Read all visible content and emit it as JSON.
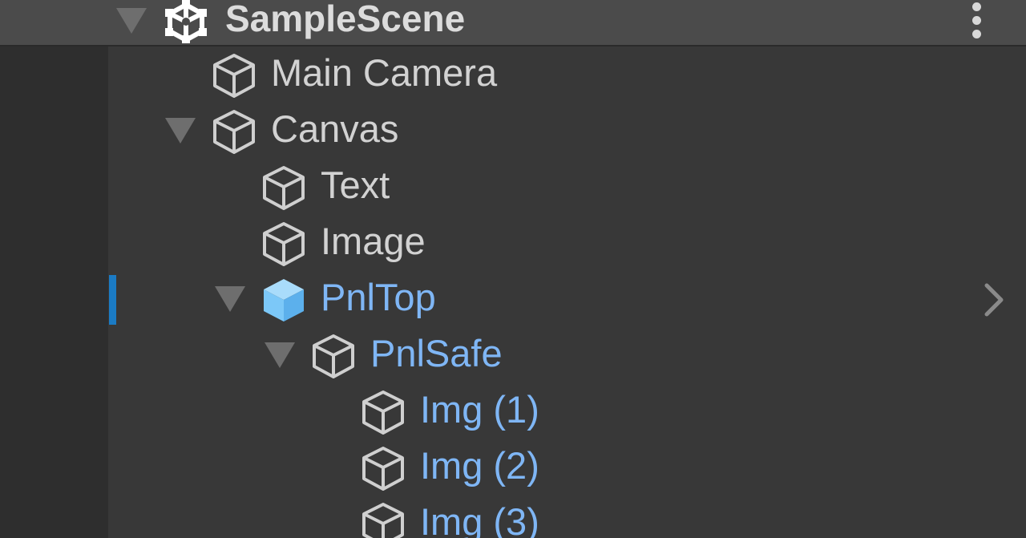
{
  "scene": {
    "name": "SampleScene"
  },
  "hierarchy": [
    {
      "name": "Main Camera",
      "depth": 1,
      "expanded": null,
      "selected": false,
      "highlighted": false
    },
    {
      "name": "Canvas",
      "depth": 1,
      "expanded": true,
      "selected": false,
      "highlighted": false
    },
    {
      "name": "Text",
      "depth": 2,
      "expanded": null,
      "selected": false,
      "highlighted": false
    },
    {
      "name": "Image",
      "depth": 2,
      "expanded": null,
      "selected": false,
      "highlighted": false
    },
    {
      "name": "PnlTop",
      "depth": 2,
      "expanded": true,
      "selected": true,
      "highlighted": true
    },
    {
      "name": "PnlSafe",
      "depth": 3,
      "expanded": true,
      "selected": false,
      "highlighted": true
    },
    {
      "name": "Img (1)",
      "depth": 4,
      "expanded": null,
      "selected": false,
      "highlighted": true
    },
    {
      "name": "Img (2)",
      "depth": 4,
      "expanded": null,
      "selected": false,
      "highlighted": true
    },
    {
      "name": "Img (3)",
      "depth": 4,
      "expanded": null,
      "selected": false,
      "highlighted": true
    }
  ],
  "colors": {
    "panel_bg": "#383838",
    "header_bg": "#4b4b4b",
    "text": "#d2d2d2",
    "highlight_text": "#7fb6f5",
    "selection_marker": "#1b7bc4",
    "selected_icon": "#7cc8f8"
  },
  "icons": {
    "scene": "unity-scene-icon",
    "menu": "kebab-menu-icon",
    "gameobject": "gameobject-cube-icon",
    "expand": "expand-arrow-icon",
    "chevron": "chevron-right-icon"
  }
}
